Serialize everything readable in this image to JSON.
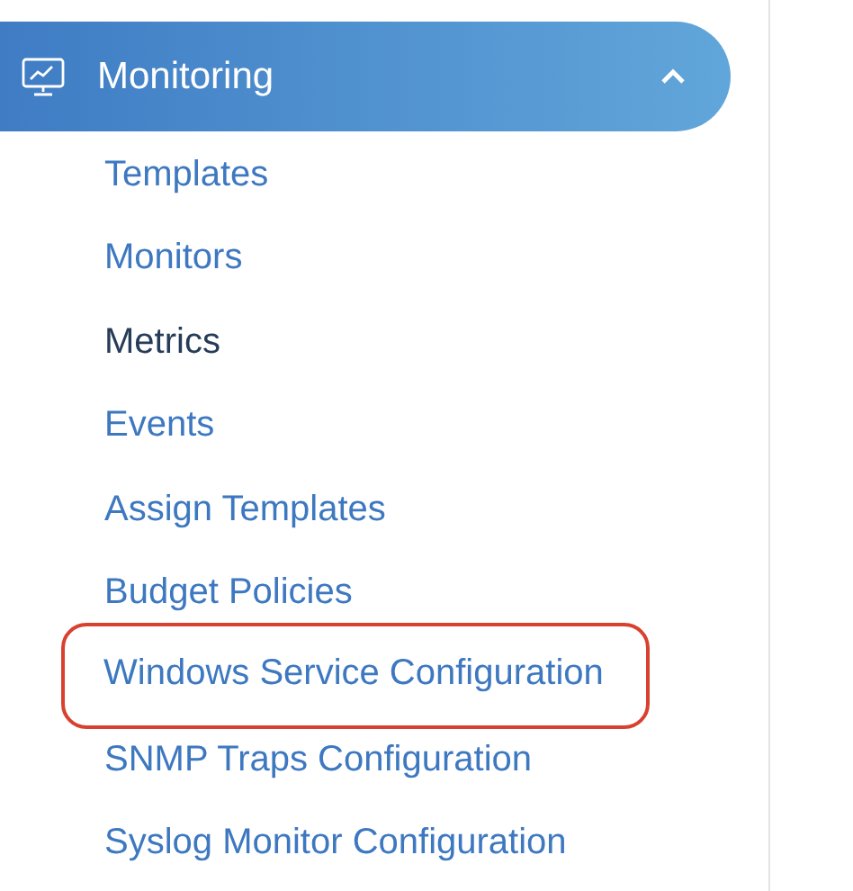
{
  "sidebar": {
    "section": {
      "label": "Monitoring",
      "expanded": true
    },
    "items": [
      {
        "label": "Templates",
        "selected": false,
        "highlighted": false
      },
      {
        "label": "Monitors",
        "selected": false,
        "highlighted": false
      },
      {
        "label": "Metrics",
        "selected": true,
        "highlighted": false
      },
      {
        "label": "Events",
        "selected": false,
        "highlighted": false
      },
      {
        "label": "Assign Templates",
        "selected": false,
        "highlighted": false
      },
      {
        "label": "Budget Policies",
        "selected": false,
        "highlighted": false
      },
      {
        "label": "Windows Service Configuration",
        "selected": false,
        "highlighted": true
      },
      {
        "label": "SNMP Traps Configuration",
        "selected": false,
        "highlighted": false
      },
      {
        "label": "Syslog Monitor Configuration",
        "selected": false,
        "highlighted": false
      }
    ]
  }
}
